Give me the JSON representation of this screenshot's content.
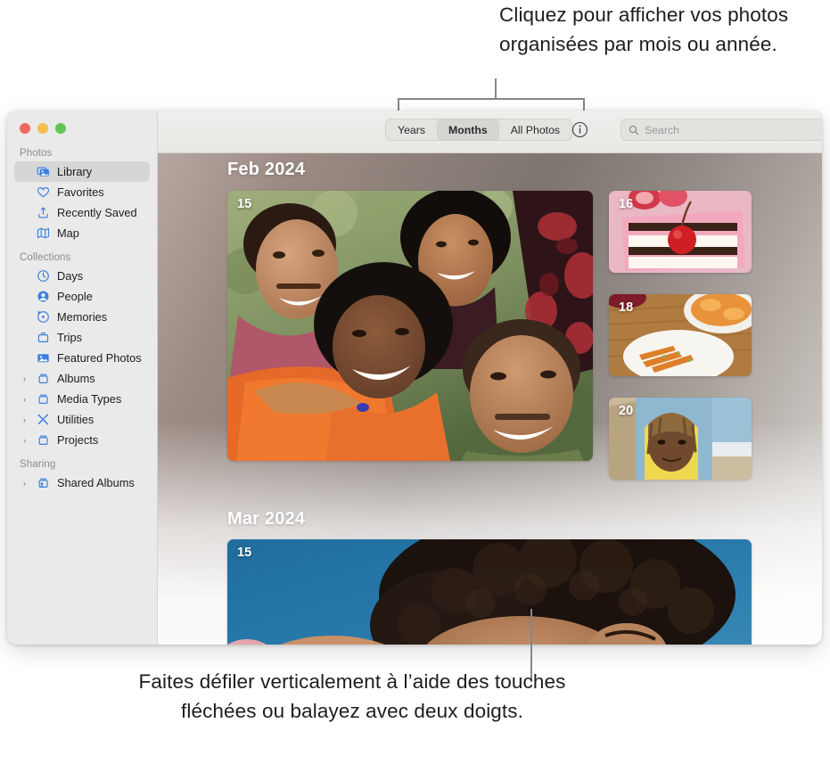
{
  "callouts": {
    "top": "Cliquez pour afficher vos photos organisées par mois ou année.",
    "bottom": "Faites défiler verticalement à l’aide des touches fléchées ou balayez avec deux doigts."
  },
  "window": {
    "traffic_lights": {
      "close_label": "close",
      "minimize_label": "minimize",
      "zoom_label": "zoom",
      "close_color": "#ee6a5f",
      "minimize_color": "#f5bd4f",
      "zoom_color": "#61c454"
    }
  },
  "sidebar": {
    "sections": [
      {
        "title": "Photos",
        "items": [
          {
            "label": "Library",
            "icon": "library-icon",
            "selected": true,
            "disclosure": false
          },
          {
            "label": "Favorites",
            "icon": "heart-icon",
            "selected": false,
            "disclosure": false
          },
          {
            "label": "Recently Saved",
            "icon": "recently-saved-icon",
            "selected": false,
            "disclosure": false
          },
          {
            "label": "Map",
            "icon": "map-icon",
            "selected": false,
            "disclosure": false
          }
        ]
      },
      {
        "title": "Collections",
        "items": [
          {
            "label": "Days",
            "icon": "clock-icon",
            "selected": false,
            "disclosure": false
          },
          {
            "label": "People",
            "icon": "person-icon",
            "selected": false,
            "disclosure": false
          },
          {
            "label": "Memories",
            "icon": "memories-icon",
            "selected": false,
            "disclosure": false
          },
          {
            "label": "Trips",
            "icon": "suitcase-icon",
            "selected": false,
            "disclosure": false
          },
          {
            "label": "Featured Photos",
            "icon": "photo-icon",
            "selected": false,
            "disclosure": false
          },
          {
            "label": "Albums",
            "icon": "album-icon",
            "selected": false,
            "disclosure": true
          },
          {
            "label": "Media Types",
            "icon": "album-icon",
            "selected": false,
            "disclosure": true
          },
          {
            "label": "Utilities",
            "icon": "tools-icon",
            "selected": false,
            "disclosure": true
          },
          {
            "label": "Projects",
            "icon": "album-icon",
            "selected": false,
            "disclosure": true
          }
        ]
      },
      {
        "title": "Sharing",
        "items": [
          {
            "label": "Shared Albums",
            "icon": "shared-album-icon",
            "selected": false,
            "disclosure": true
          }
        ]
      }
    ]
  },
  "toolbar": {
    "segments": [
      {
        "label": "Years",
        "active": false
      },
      {
        "label": "Months",
        "active": true
      },
      {
        "label": "All Photos",
        "active": false
      }
    ],
    "info_icon": "info-icon",
    "search": {
      "icon": "search-icon",
      "placeholder": "Search",
      "value": ""
    }
  },
  "grid": {
    "months": [
      {
        "header": "Feb 2024",
        "photos": [
          {
            "day": "15",
            "description": "group selfie of four friends outdoors"
          },
          {
            "day": "16",
            "description": "pink layered cake slice with cherry and strawberries"
          },
          {
            "day": "18",
            "description": "plate of roasted carrots and orange slices on wood table"
          },
          {
            "day": "20",
            "description": "person in yellow hood at the beach"
          }
        ]
      },
      {
        "header": "Mar 2024",
        "photos": [
          {
            "day": "15",
            "description": "person with curly hair lying on blue background"
          }
        ]
      }
    ]
  }
}
